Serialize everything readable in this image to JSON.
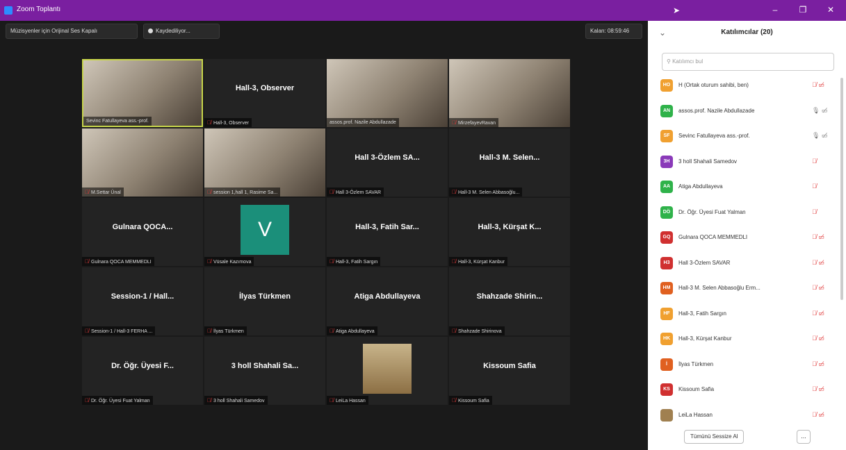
{
  "window": {
    "title": "Zoom Toplantı",
    "buttons": {
      "minimize": "–",
      "maximize": "❐",
      "close": "✕"
    }
  },
  "toolbar": {
    "original_sound": "Müzisyenler için Orijinal Ses Kapalı",
    "recording": "Kaydediliyor...",
    "remaining": "Kalan: 08:59:46"
  },
  "tiles": [
    {
      "title": "",
      "label": "Sevinc Fatullayeva ass.-prof.",
      "video": true,
      "muted": false,
      "active": true
    },
    {
      "title": "Hall-3, Observer",
      "label": "Hall-3, Observer",
      "muted": true
    },
    {
      "title": "",
      "label": "assos.prof. Nazile Abdullazade",
      "video": true,
      "muted": false
    },
    {
      "title": "",
      "label": "MirzefayevRavan",
      "video": true,
      "muted": true
    },
    {
      "title": "",
      "label": "M.Settar Ünal",
      "video": true,
      "muted": true
    },
    {
      "title": "",
      "label": "session 1,hall 1, Rasime Sa...",
      "video": true,
      "muted": true
    },
    {
      "title": "Hall 3-Özlem SA...",
      "label": "Hall 3-Özlem SAVAR",
      "muted": true
    },
    {
      "title": "Hall-3 M. Selen...",
      "label": "Hall-3 M. Selen Abbasoğlu...",
      "muted": true
    },
    {
      "title": "Gulnara QOCA...",
      "label": "Gulnara QOCA MEMMEDLI",
      "muted": true
    },
    {
      "title": "",
      "label": "Vüsale Kazımova",
      "avatar": "V",
      "muted": true
    },
    {
      "title": "Hall-3, Fatih Sar...",
      "label": "Hall-3, Fatih Sargın",
      "muted": true
    },
    {
      "title": "Hall-3, Kürşat K...",
      "label": "Hall-3, Kürşat Kanbur",
      "muted": true
    },
    {
      "title": "Session-1 / Hall...",
      "label": "Session-1 / Hall-3 FERHA ...",
      "muted": true
    },
    {
      "title": "İlyas Türkmen",
      "label": "İlyas Türkmen",
      "muted": true
    },
    {
      "title": "Atiga Abdullayeva",
      "label": "Atiga Abdullayeva",
      "muted": true
    },
    {
      "title": "Shahzade Shirin...",
      "label": "Shahzade Shirinova",
      "muted": true
    },
    {
      "title": "Dr. Öğr. Üyesi F...",
      "label": "Dr. Öğr. Üyesi Fuat Yalman",
      "muted": true
    },
    {
      "title": "3 holl Shahali Sa...",
      "label": "3 holl Shahali Samedov",
      "muted": true
    },
    {
      "title": "",
      "label": "LeiLa Hassan",
      "image": true,
      "muted": true
    },
    {
      "title": "Kissoum Safia",
      "label": "Kissoum Safia",
      "muted": true
    }
  ],
  "participants_panel": {
    "title": "Katılımcılar (20)",
    "search_placeholder": "Katılımcı bul",
    "mute_all": "Tümünü Sessize Al",
    "more": "...",
    "participants": [
      {
        "initials": "HO",
        "color": "#f0a030",
        "name": "H (Ortak oturum sahibi, ben)",
        "icons": "🎙̸ ▭̸",
        "muted": true
      },
      {
        "initials": "AN",
        "color": "#2fb24a",
        "name": "assos.prof. Nazile Abdullazade",
        "icons": "🎙 ▭̸",
        "muted": false
      },
      {
        "initials": "SF",
        "color": "#f0a030",
        "name": "Sevinc Fatullayeva ass.-prof.",
        "icons": "🎙 ▭̸",
        "muted": false
      },
      {
        "initials": "3H",
        "color": "#8a3ab9",
        "name": "3 holl Shahali Samedov",
        "icons": "🎙̸",
        "muted": true
      },
      {
        "initials": "AA",
        "color": "#2fb24a",
        "name": "Atiga Abdullayeva",
        "icons": "🎙̸",
        "muted": true
      },
      {
        "initials": "DÖ",
        "color": "#2fb24a",
        "name": "Dr. Öğr. Üyesi Fuat Yalman",
        "icons": "🎙̸",
        "muted": true
      },
      {
        "initials": "GQ",
        "color": "#d03030",
        "name": "Gulnara QOCA MEMMEDLI",
        "icons": "🎙̸ ▭̸",
        "muted": true
      },
      {
        "initials": "H3",
        "color": "#d03030",
        "name": "Hall 3-Özlem SAVAR",
        "icons": "🎙̸ ▭̸",
        "muted": true
      },
      {
        "initials": "HM",
        "color": "#e06020",
        "name": "Hall-3 M. Selen Abbasoğlu Erm...",
        "icons": "🎙̸ ▭̸",
        "muted": true
      },
      {
        "initials": "HF",
        "color": "#f0a030",
        "name": "Hall-3, Fatih Sargın",
        "icons": "🎙̸ ▭̸",
        "muted": true
      },
      {
        "initials": "HK",
        "color": "#f0a030",
        "name": "Hall-3, Kürşat Kanbur",
        "icons": "🎙̸ ▭̸",
        "muted": true
      },
      {
        "initials": "İ",
        "color": "#e06020",
        "name": "İlyas Türkmen",
        "icons": "🎙̸ ▭̸",
        "muted": true
      },
      {
        "initials": "KS",
        "color": "#d03030",
        "name": "Kissoum Safia",
        "icons": "🎙̸ ▭̸",
        "muted": true
      },
      {
        "initials": "",
        "color": "#a08050",
        "name": "LeiLa Hassan",
        "icons": "🎙̸ ▭̸",
        "muted": true
      }
    ]
  }
}
